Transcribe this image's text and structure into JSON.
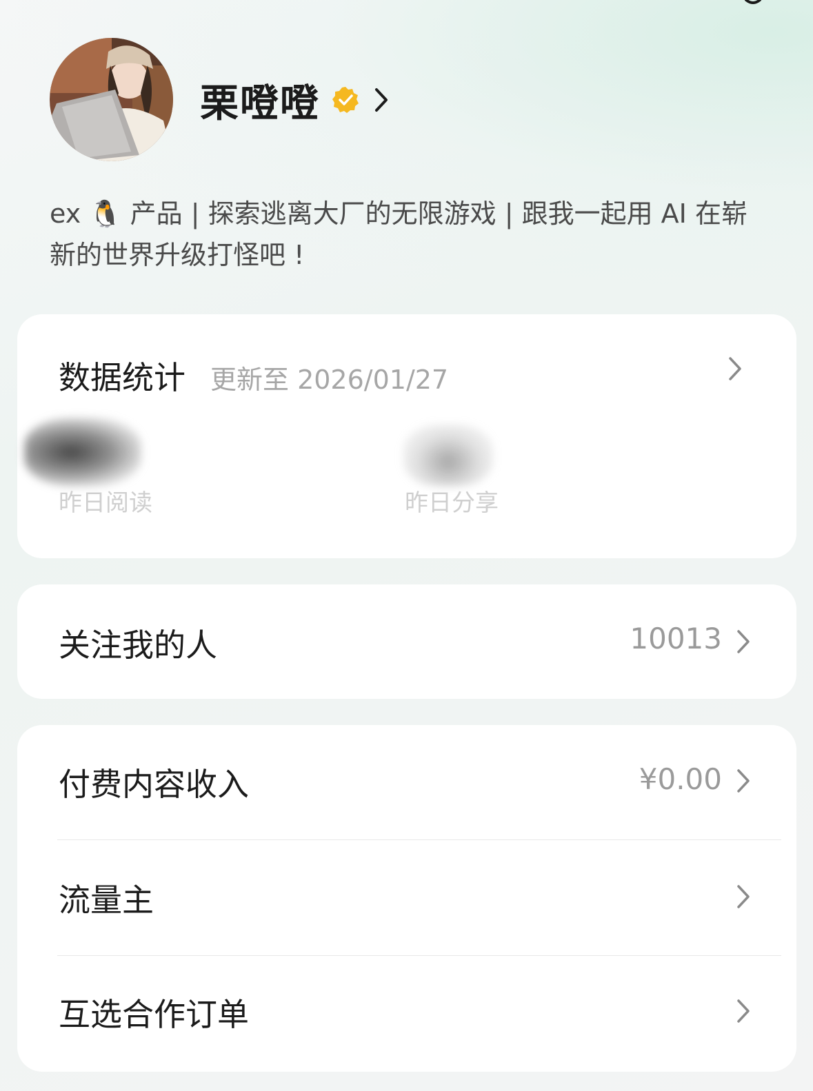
{
  "profile": {
    "name": "栗噔噔",
    "bio": "ex 🐧 产品 | 探索逃离大厂的无限游戏 | 跟我一起用 AI 在崭新的世界升级打怪吧 !"
  },
  "stats": {
    "title": "数据统计",
    "updated": "更新至 2026/01/27",
    "items": [
      {
        "label": "昨日阅读"
      },
      {
        "label": "昨日分享"
      }
    ]
  },
  "followers": {
    "label": "关注我的人",
    "value": "10013"
  },
  "menu": {
    "items": [
      {
        "label": "付费内容收入",
        "value": "¥0.00"
      },
      {
        "label": "流量主",
        "value": ""
      },
      {
        "label": "互选合作订单",
        "value": ""
      }
    ]
  },
  "colors": {
    "verified": "#f5b820",
    "text_primary": "#1b1b1b",
    "text_secondary": "#a6a6a6"
  },
  "icons": [
    "settings-icon",
    "verified-badge-icon",
    "chevron-right-icon"
  ]
}
